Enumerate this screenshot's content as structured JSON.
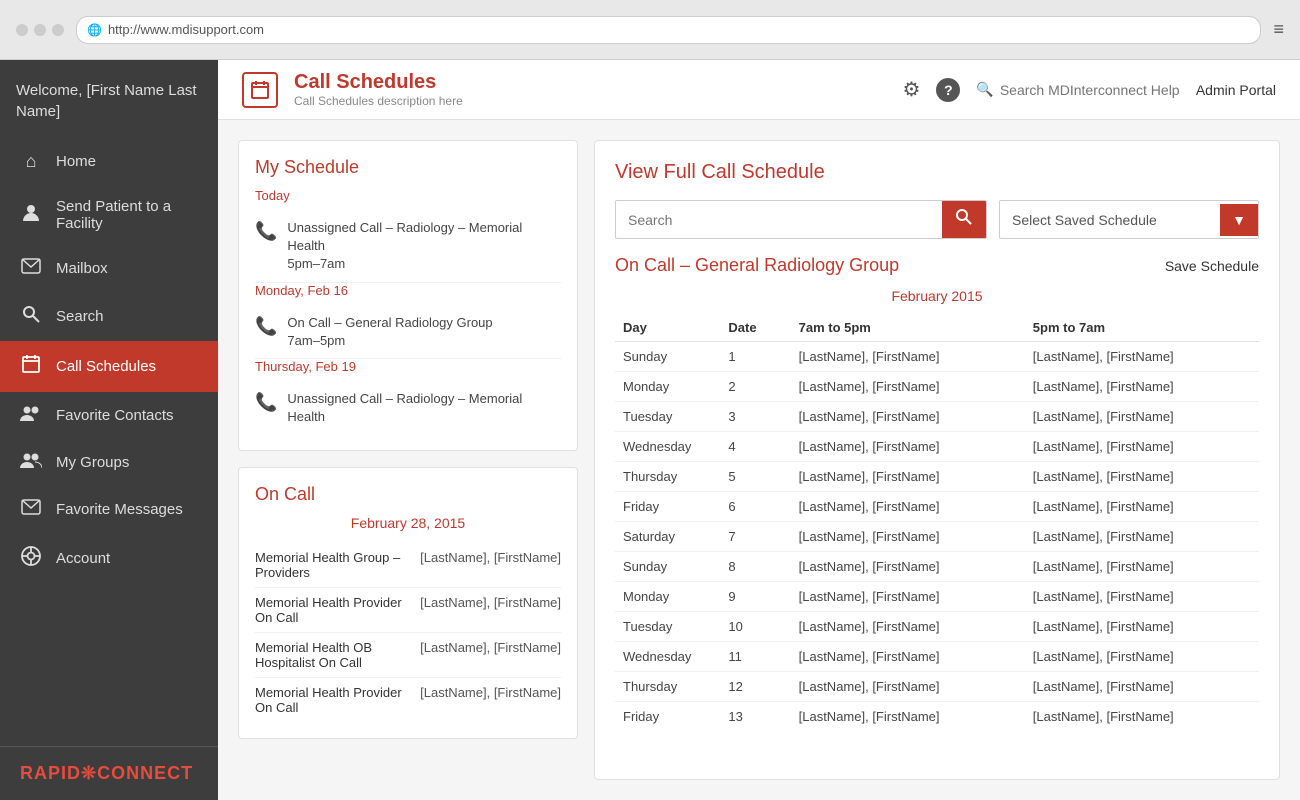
{
  "browser": {
    "url": "http://www.mdisupport.com",
    "menu_icon": "≡"
  },
  "sidebar": {
    "welcome": "Welcome,\n[First Name\nLast Name]",
    "items": [
      {
        "id": "home",
        "label": "Home",
        "icon": "⌂",
        "active": false
      },
      {
        "id": "send-patient",
        "label": "Send Patient to a Facility",
        "icon": "👤",
        "active": false
      },
      {
        "id": "mailbox",
        "label": "Mailbox",
        "icon": "✉",
        "active": false
      },
      {
        "id": "search",
        "label": "Search",
        "icon": "🔍",
        "active": false
      },
      {
        "id": "call-schedules",
        "label": "Call Schedules",
        "icon": "📅",
        "active": true
      },
      {
        "id": "favorite-contacts",
        "label": "Favorite Contacts",
        "icon": "👥",
        "active": false
      },
      {
        "id": "my-groups",
        "label": "My Groups",
        "icon": "👥",
        "active": false
      },
      {
        "id": "favorite-messages",
        "label": "Favorite Messages",
        "icon": "✉",
        "active": false
      },
      {
        "id": "account",
        "label": "Account",
        "icon": "⚙",
        "active": false
      }
    ],
    "logo": "RAPID❊CONNECT"
  },
  "topbar": {
    "page_title": "Call Schedules",
    "page_description": "Call Schedules description here",
    "search_placeholder": "Search MDInterconnect Help",
    "admin_portal": "Admin Portal"
  },
  "my_schedule": {
    "title": "My Schedule",
    "dates": [
      {
        "label": "Today",
        "items": [
          {
            "text": "Unassigned Call – Radiology – Memorial Health",
            "sub": "5pm–7am"
          }
        ]
      },
      {
        "label": "Monday, Feb 16",
        "items": [
          {
            "text": "On Call – General Radiology Group",
            "sub": "7am–5pm"
          }
        ]
      },
      {
        "label": "Thursday, Feb 19",
        "items": [
          {
            "text": "Unassigned Call – Radiology – Memorial Health",
            "sub": ""
          }
        ]
      }
    ]
  },
  "on_call": {
    "title": "On Call",
    "date": "February 28, 2015",
    "rows": [
      {
        "group": "Memorial Health Group – Providers",
        "name": "[LastName], [FirstName]"
      },
      {
        "group": "Memorial Health Provider On Call",
        "name": "[LastName], [FirstName]"
      },
      {
        "group": "Memorial Health OB Hospitalist On Call",
        "name": "[LastName], [FirstName]"
      },
      {
        "group": "Memorial Health Provider On Call",
        "name": "[LastName], [FirstName]"
      }
    ]
  },
  "full_schedule": {
    "title": "View Full Call Schedule",
    "on_call_group": "On Call – General Radiology Group",
    "save_schedule": "Save Schedule",
    "search_placeholder": "Search",
    "saved_schedule_placeholder": "Select Saved Schedule",
    "month": "February 2015",
    "headers": {
      "day": "Day",
      "date": "Date",
      "col1": "7am to 5pm",
      "col2": "5pm to 7am"
    },
    "rows": [
      {
        "day": "Sunday",
        "date": "1",
        "col1": "[LastName], [FirstName]",
        "col2": "[LastName], [FirstName]"
      },
      {
        "day": "Monday",
        "date": "2",
        "col1": "[LastName], [FirstName]",
        "col2": "[LastName], [FirstName]"
      },
      {
        "day": "Tuesday",
        "date": "3",
        "col1": "[LastName], [FirstName]",
        "col2": "[LastName], [FirstName]"
      },
      {
        "day": "Wednesday",
        "date": "4",
        "col1": "[LastName], [FirstName]",
        "col2": "[LastName], [FirstName]"
      },
      {
        "day": "Thursday",
        "date": "5",
        "col1": "[LastName], [FirstName]",
        "col2": "[LastName], [FirstName]"
      },
      {
        "day": "Friday",
        "date": "6",
        "col1": "[LastName], [FirstName]",
        "col2": "[LastName], [FirstName]"
      },
      {
        "day": "Saturday",
        "date": "7",
        "col1": "[LastName], [FirstName]",
        "col2": "[LastName], [FirstName]"
      },
      {
        "day": "Sunday",
        "date": "8",
        "col1": "[LastName], [FirstName]",
        "col2": "[LastName], [FirstName]"
      },
      {
        "day": "Monday",
        "date": "9",
        "col1": "[LastName], [FirstName]",
        "col2": "[LastName], [FirstName]"
      },
      {
        "day": "Tuesday",
        "date": "10",
        "col1": "[LastName], [FirstName]",
        "col2": "[LastName], [FirstName]"
      },
      {
        "day": "Wednesday",
        "date": "11",
        "col1": "[LastName], [FirstName]",
        "col2": "[LastName], [FirstName]"
      },
      {
        "day": "Thursday",
        "date": "12",
        "col1": "[LastName], [FirstName]",
        "col2": "[LastName], [FirstName]"
      },
      {
        "day": "Friday",
        "date": "13",
        "col1": "[LastName], [FirstName]",
        "col2": "[LastName], [FirstName]"
      }
    ]
  }
}
